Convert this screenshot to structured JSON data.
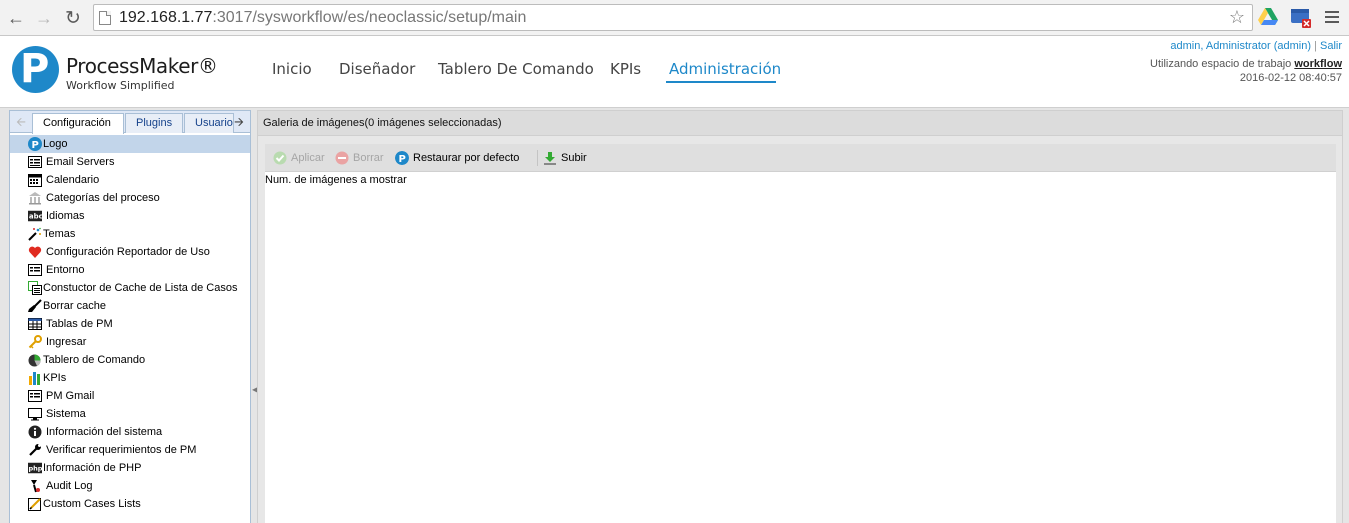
{
  "browser": {
    "url_host": "192.168.1.77",
    "url_rest": ":3017/sysworkflow/es/neoclassic/setup/main"
  },
  "header": {
    "logo_name": "ProcessMaker®",
    "logo_tagline": "Workflow Simplified",
    "nav": {
      "home": "Inicio",
      "designer": "Diseñador",
      "dashboard": "Tablero De Comando",
      "kpis": "KPIs",
      "admin": "Administración"
    },
    "user": "admin, Administrator (admin)",
    "separator": "|",
    "logout": "Salir",
    "workspace_label": "Utilizando espacio de trabajo",
    "workspace_name": "workflow",
    "datetime": "2016-02-12 08:40:57"
  },
  "left_panel": {
    "tabs": {
      "config": "Configuración",
      "plugins": "Plugins",
      "users": "Usuarios"
    },
    "tree": [
      {
        "label": "Logo"
      },
      {
        "label": "Email Servers"
      },
      {
        "label": "Calendario"
      },
      {
        "label": "Categorías del proceso"
      },
      {
        "label": "Idiomas"
      },
      {
        "label": "Temas"
      },
      {
        "label": "Configuración Reportador de Uso"
      },
      {
        "label": "Entorno"
      },
      {
        "label": "Constuctor de Cache de Lista de Casos"
      },
      {
        "label": "Borrar cache"
      },
      {
        "label": "Tablas de PM"
      },
      {
        "label": "Ingresar"
      },
      {
        "label": "Tablero de Comando"
      },
      {
        "label": "KPIs"
      },
      {
        "label": "PM Gmail"
      },
      {
        "label": "Sistema"
      },
      {
        "label": "Información del sistema"
      },
      {
        "label": "Verificar requerimientos de PM"
      },
      {
        "label": "Información de PHP"
      },
      {
        "label": "Audit Log"
      },
      {
        "label": "Custom Cases Lists"
      }
    ]
  },
  "right_panel": {
    "title": "Galeria de imágenes",
    "title_count": "(0 imágenes seleccionadas)",
    "toolbar": {
      "apply": "Aplicar",
      "delete": "Borrar",
      "restore": "Restaurar por defecto",
      "upload": "Subir"
    },
    "num_images_label": "Num. de imágenes a mostrar"
  },
  "colors": {
    "accent": "#1e88c9",
    "selected_row": "#c2d5ea"
  }
}
